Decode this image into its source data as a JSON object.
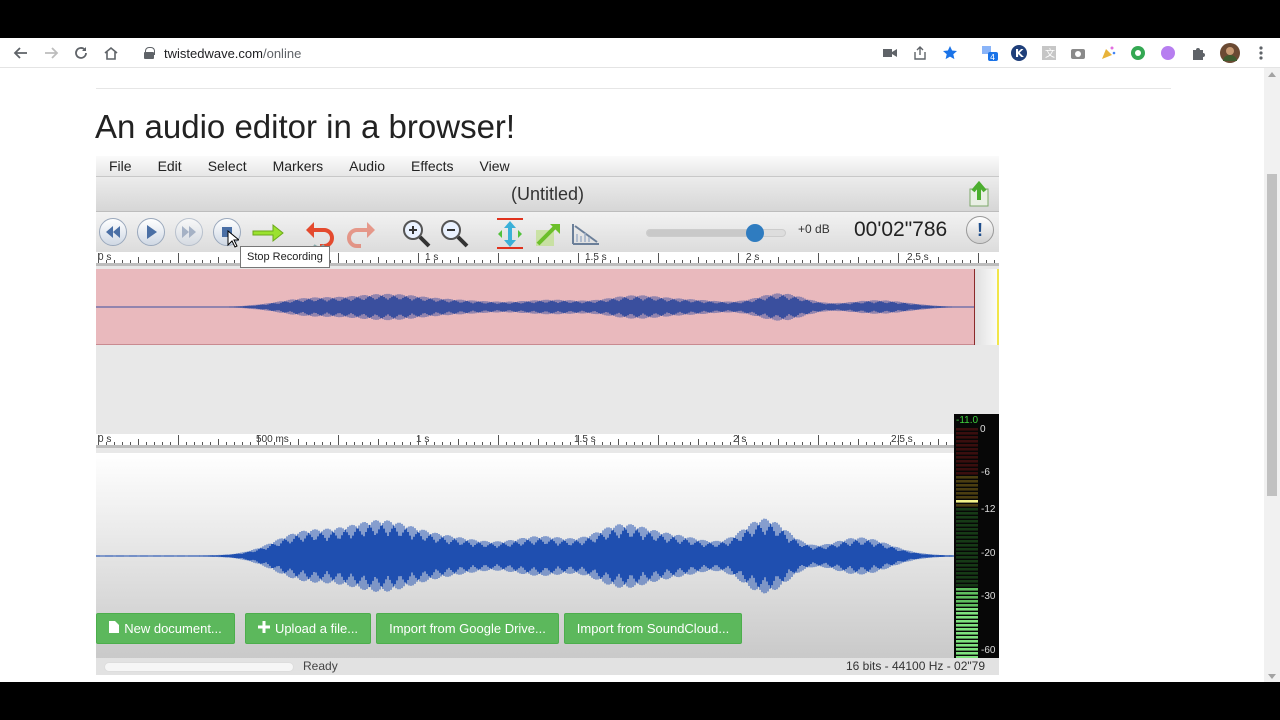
{
  "browser": {
    "url_domain": "twistedwave.com",
    "url_path": "/online",
    "extension_badge": "4"
  },
  "page": {
    "heading": "An audio editor in a browser!"
  },
  "editor": {
    "menu": [
      "File",
      "Edit",
      "Select",
      "Markers",
      "Audio",
      "Effects",
      "View"
    ],
    "doc_title": "(Untitled)",
    "gain_label": "+0 dB",
    "gain_level": 0.78,
    "time_display": "00'02\"786",
    "tooltip": "Stop Recording",
    "overview_ruler": [
      "0 s",
      "1 s",
      "1.5 s",
      "2 s",
      "2.5 s"
    ],
    "main_ruler": [
      "0 s",
      "500 ms",
      "1 s",
      "1.5 s",
      "2 s",
      "2.5 s"
    ],
    "vu": {
      "peak": "-11.0",
      "scale": [
        "0",
        "-6",
        "-12",
        "-20",
        "-30",
        "-60"
      ]
    },
    "status": "Ready",
    "format_info": "16 bits - 44100 Hz - 02\"79"
  },
  "actions": {
    "new_document": "New document...",
    "upload_file": "Upload a file...",
    "import_drive": "Import from Google Drive...",
    "import_soundcloud": "Import from SoundCloud..."
  }
}
